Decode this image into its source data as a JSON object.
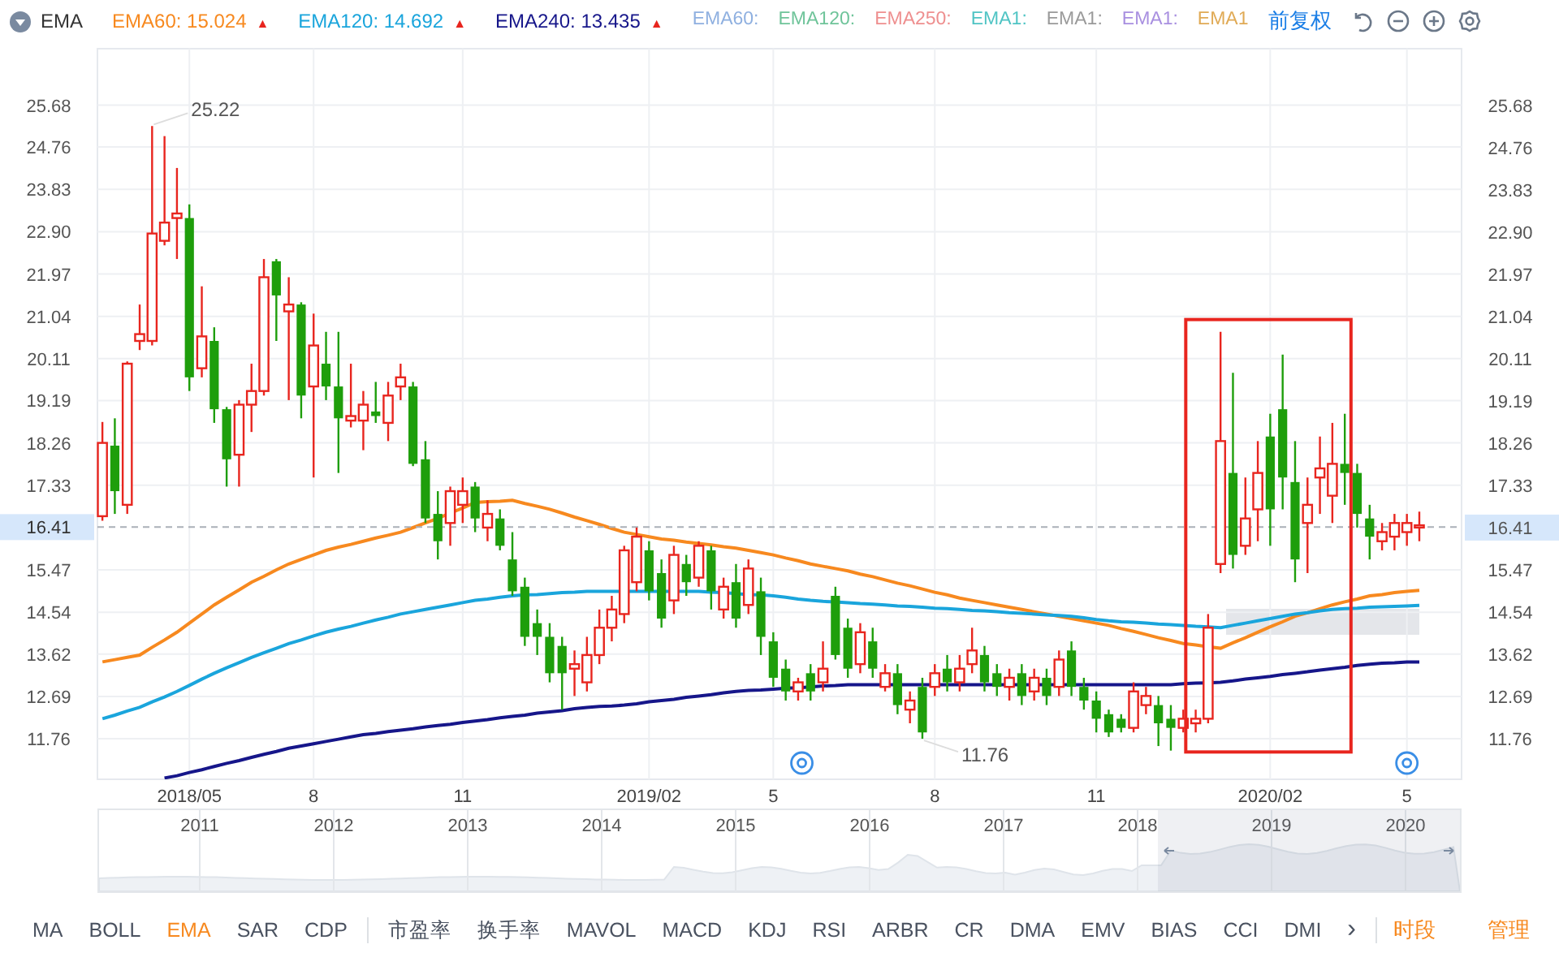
{
  "legend": {
    "indicator": "EMA",
    "values": [
      {
        "label": "EMA60: 15.024",
        "color": "#f7891f",
        "marker": "▲"
      },
      {
        "label": "EMA120: 14.692",
        "color": "#1aa5dc",
        "marker": "▲"
      },
      {
        "label": "EMA240: 13.435",
        "color": "#16168a",
        "marker": "▲"
      }
    ],
    "inactive": [
      {
        "label": "EMA60:",
        "color": "#8fb0e0"
      },
      {
        "label": "EMA120:",
        "color": "#6fc49a"
      },
      {
        "label": "EMA250:",
        "color": "#ee8f8f"
      },
      {
        "label": "EMA1:",
        "color": "#4fc4c4"
      },
      {
        "label": "EMA1:",
        "color": "#9a9a9a"
      },
      {
        "label": "EMA1:",
        "color": "#a88fe0"
      },
      {
        "label": "EMA1",
        "color": "#e0aa55"
      }
    ],
    "adjust": "前复权"
  },
  "chart_data": {
    "type": "candlestick",
    "ylim": [
      10.87,
      26.92
    ],
    "grid": true,
    "yticks": [
      {
        "value": 25.68,
        "label": "25.68"
      },
      {
        "value": 24.76,
        "label": "24.76"
      },
      {
        "value": 23.83,
        "label": "23.83"
      },
      {
        "value": 22.9,
        "label": "22.90"
      },
      {
        "value": 21.97,
        "label": "21.97"
      },
      {
        "value": 21.04,
        "label": "21.04"
      },
      {
        "value": 20.11,
        "label": "20.11"
      },
      {
        "value": 19.19,
        "label": "19.19"
      },
      {
        "value": 18.26,
        "label": "18.26"
      },
      {
        "value": 17.33,
        "label": "17.33"
      },
      {
        "value": 15.47,
        "label": "15.47"
      },
      {
        "value": 14.54,
        "label": "14.54"
      },
      {
        "value": 13.62,
        "label": "13.62"
      },
      {
        "value": 12.69,
        "label": "12.69"
      },
      {
        "value": 11.76,
        "label": "11.76"
      }
    ],
    "categories": [
      null,
      null,
      null,
      null,
      null,
      null,
      null,
      "2018/05",
      null,
      null,
      null,
      null,
      null,
      null,
      null,
      null,
      null,
      "8",
      null,
      null,
      null,
      null,
      null,
      null,
      null,
      null,
      null,
      null,
      null,
      "11",
      null,
      null,
      null,
      null,
      null,
      null,
      null,
      null,
      null,
      null,
      null,
      null,
      null,
      null,
      "2019/02",
      null,
      null,
      null,
      null,
      null,
      null,
      null,
      null,
      null,
      "5",
      null,
      null,
      null,
      null,
      null,
      null,
      null,
      null,
      null,
      null,
      null,
      null,
      "8",
      null,
      null,
      null,
      null,
      null,
      null,
      null,
      null,
      null,
      null,
      null,
      null,
      "11",
      null,
      null,
      null,
      null,
      null,
      null,
      null,
      null,
      null,
      null,
      null,
      null,
      null,
      "2020/02",
      null,
      null,
      null,
      null,
      null,
      null,
      null,
      null,
      null,
      null,
      "5",
      null
    ],
    "ohlc": [
      [
        16.65,
        18.72,
        16.55,
        18.26
      ],
      [
        18.2,
        18.8,
        16.7,
        17.2
      ],
      [
        16.9,
        20.05,
        16.7,
        20.0
      ],
      [
        20.5,
        21.3,
        20.3,
        20.65
      ],
      [
        20.5,
        25.22,
        20.4,
        22.86
      ],
      [
        22.7,
        25.0,
        22.6,
        23.1
      ],
      [
        23.2,
        24.3,
        22.3,
        23.3
      ],
      [
        23.2,
        23.5,
        19.4,
        19.7
      ],
      [
        19.9,
        21.7,
        19.7,
        20.6
      ],
      [
        20.5,
        20.8,
        18.7,
        19.0
      ],
      [
        19.0,
        19.05,
        17.3,
        17.9
      ],
      [
        18.0,
        19.2,
        17.3,
        19.1
      ],
      [
        19.1,
        20.0,
        18.5,
        19.4
      ],
      [
        19.4,
        22.3,
        19.3,
        21.9
      ],
      [
        22.25,
        22.3,
        20.5,
        21.5
      ],
      [
        21.15,
        21.9,
        19.2,
        21.3
      ],
      [
        21.3,
        21.35,
        18.8,
        19.3
      ],
      [
        19.5,
        21.1,
        17.5,
        20.4
      ],
      [
        20.0,
        20.7,
        19.2,
        19.5
      ],
      [
        19.5,
        20.7,
        17.6,
        18.8
      ],
      [
        18.75,
        20.0,
        18.6,
        18.85
      ],
      [
        18.75,
        19.4,
        18.1,
        19.1
      ],
      [
        18.95,
        19.6,
        18.7,
        18.85
      ],
      [
        18.7,
        19.6,
        18.3,
        19.3
      ],
      [
        19.5,
        20.0,
        19.2,
        19.7
      ],
      [
        19.5,
        19.6,
        17.75,
        17.8
      ],
      [
        17.9,
        18.3,
        16.5,
        16.6
      ],
      [
        16.7,
        17.2,
        15.7,
        16.1
      ],
      [
        16.5,
        17.3,
        16.0,
        17.2
      ],
      [
        16.9,
        17.5,
        16.5,
        17.2
      ],
      [
        17.3,
        17.4,
        16.3,
        16.6
      ],
      [
        16.4,
        17.0,
        16.1,
        16.7
      ],
      [
        16.6,
        16.8,
        15.9,
        16.0
      ],
      [
        15.7,
        16.3,
        14.9,
        15.0
      ],
      [
        15.1,
        15.3,
        13.8,
        14.0
      ],
      [
        14.3,
        14.6,
        13.6,
        14.0
      ],
      [
        14.0,
        14.3,
        13.0,
        13.2
      ],
      [
        13.8,
        14.0,
        12.4,
        13.2
      ],
      [
        13.3,
        13.7,
        12.7,
        13.4
      ],
      [
        13.0,
        14.0,
        12.8,
        13.6
      ],
      [
        13.6,
        14.6,
        13.4,
        14.2
      ],
      [
        14.2,
        14.9,
        13.9,
        14.6
      ],
      [
        14.5,
        16.0,
        14.3,
        15.9
      ],
      [
        15.2,
        16.4,
        15.0,
        16.2
      ],
      [
        15.9,
        16.1,
        14.8,
        15.0
      ],
      [
        15.4,
        15.7,
        14.2,
        14.4
      ],
      [
        14.8,
        16.0,
        14.5,
        15.8
      ],
      [
        15.6,
        15.8,
        14.9,
        15.2
      ],
      [
        15.3,
        16.1,
        15.1,
        16.0
      ],
      [
        15.9,
        16.0,
        14.6,
        15.0
      ],
      [
        14.6,
        15.3,
        14.4,
        15.1
      ],
      [
        15.2,
        15.6,
        14.2,
        14.4
      ],
      [
        14.7,
        15.7,
        14.5,
        15.5
      ],
      [
        15.0,
        15.3,
        13.6,
        14.0
      ],
      [
        13.9,
        14.1,
        12.9,
        13.1
      ],
      [
        13.3,
        13.5,
        12.6,
        12.8
      ],
      [
        12.8,
        13.1,
        12.6,
        13.0
      ],
      [
        13.2,
        13.4,
        12.6,
        12.8
      ],
      [
        13.0,
        13.9,
        12.8,
        13.3
      ],
      [
        14.9,
        15.1,
        13.5,
        13.6
      ],
      [
        14.2,
        14.4,
        13.1,
        13.3
      ],
      [
        13.4,
        14.3,
        13.2,
        14.1
      ],
      [
        13.9,
        14.2,
        13.1,
        13.3
      ],
      [
        12.9,
        13.4,
        12.8,
        13.2
      ],
      [
        13.2,
        13.4,
        12.3,
        12.5
      ],
      [
        12.4,
        12.8,
        12.1,
        12.6
      ],
      [
        12.9,
        13.1,
        11.76,
        11.9
      ],
      [
        12.9,
        13.4,
        12.7,
        13.2
      ],
      [
        13.3,
        13.6,
        12.8,
        13.0
      ],
      [
        13.0,
        13.6,
        12.8,
        13.3
      ],
      [
        13.4,
        14.2,
        13.2,
        13.7
      ],
      [
        13.6,
        13.8,
        12.8,
        13.0
      ],
      [
        13.2,
        13.4,
        12.7,
        12.9
      ],
      [
        12.9,
        13.3,
        12.6,
        13.1
      ],
      [
        13.2,
        13.4,
        12.5,
        12.7
      ],
      [
        12.8,
        13.3,
        12.6,
        13.1
      ],
      [
        13.1,
        13.3,
        12.5,
        12.7
      ],
      [
        12.9,
        13.7,
        12.7,
        13.5
      ],
      [
        13.7,
        13.9,
        12.7,
        12.9
      ],
      [
        12.9,
        13.1,
        12.4,
        12.6
      ],
      [
        12.6,
        12.8,
        11.9,
        12.2
      ],
      [
        12.3,
        12.4,
        11.8,
        11.9
      ],
      [
        12.2,
        12.3,
        11.9,
        12.0
      ],
      [
        12.0,
        13.0,
        11.9,
        12.8
      ],
      [
        12.5,
        12.9,
        12.3,
        12.7
      ],
      [
        12.5,
        12.7,
        11.6,
        12.1
      ],
      [
        12.2,
        12.5,
        11.5,
        12.0
      ],
      [
        12.0,
        12.4,
        11.9,
        12.2
      ],
      [
        12.1,
        12.4,
        11.9,
        12.2
      ],
      [
        12.2,
        14.5,
        12.1,
        14.2
      ],
      [
        15.6,
        20.7,
        15.4,
        18.3
      ],
      [
        17.6,
        19.8,
        15.5,
        15.8
      ],
      [
        16.0,
        17.5,
        15.8,
        16.6
      ],
      [
        16.8,
        18.3,
        16.1,
        17.6
      ],
      [
        18.4,
        18.9,
        16.0,
        16.8
      ],
      [
        19.0,
        20.2,
        16.8,
        17.5
      ],
      [
        17.4,
        18.3,
        15.2,
        15.7
      ],
      [
        16.5,
        17.5,
        15.4,
        16.9
      ],
      [
        17.5,
        18.4,
        16.7,
        17.7
      ],
      [
        17.1,
        18.7,
        16.5,
        17.8
      ],
      [
        17.8,
        18.9,
        16.9,
        17.6
      ],
      [
        17.6,
        17.8,
        16.4,
        16.7
      ],
      [
        16.6,
        16.9,
        15.7,
        16.2
      ],
      [
        16.1,
        16.5,
        15.9,
        16.3
      ],
      [
        16.2,
        16.7,
        15.9,
        16.5
      ],
      [
        16.3,
        16.7,
        16.0,
        16.5
      ],
      [
        16.4,
        16.75,
        16.1,
        16.45
      ]
    ],
    "series": [
      {
        "type": "line",
        "color": "#f7891f",
        "values": [
          13.45,
          13.5,
          13.55,
          13.6,
          13.77,
          13.93,
          14.1,
          14.3,
          14.5,
          14.7,
          14.87,
          15.03,
          15.2,
          15.33,
          15.47,
          15.6,
          15.7,
          15.8,
          15.9,
          15.97,
          16.03,
          16.1,
          16.17,
          16.23,
          16.3,
          16.4,
          16.5,
          16.6,
          16.72,
          16.83,
          16.95,
          16.97,
          16.98,
          17.0,
          16.93,
          16.87,
          16.8,
          16.72,
          16.63,
          16.55,
          16.47,
          16.38,
          16.3,
          16.25,
          16.2,
          16.15,
          16.12,
          16.08,
          16.05,
          16.02,
          15.98,
          15.95,
          15.9,
          15.85,
          15.8,
          15.73,
          15.67,
          15.6,
          15.55,
          15.5,
          15.45,
          15.38,
          15.32,
          15.25,
          15.18,
          15.12,
          15.05,
          14.98,
          14.92,
          14.85,
          14.8,
          14.75,
          14.7,
          14.65,
          14.6,
          14.55,
          14.5,
          14.45,
          14.4,
          14.35,
          14.3,
          14.25,
          14.18,
          14.12,
          14.05,
          13.98,
          13.92,
          13.85,
          13.82,
          13.78,
          13.75,
          13.87,
          13.98,
          14.1,
          14.22,
          14.33,
          14.45,
          14.53,
          14.62,
          14.7,
          14.77,
          14.83,
          14.9,
          14.93,
          14.97,
          15.0,
          15.02
        ]
      },
      {
        "type": "line",
        "color": "#1aa5dc",
        "values": [
          12.2,
          12.28,
          12.37,
          12.45,
          12.57,
          12.68,
          12.8,
          12.93,
          13.07,
          13.2,
          13.32,
          13.43,
          13.55,
          13.65,
          13.75,
          13.85,
          13.93,
          14.02,
          14.1,
          14.17,
          14.23,
          14.3,
          14.37,
          14.43,
          14.5,
          14.55,
          14.6,
          14.65,
          14.7,
          14.75,
          14.8,
          14.83,
          14.87,
          14.9,
          14.92,
          14.93,
          14.95,
          14.97,
          14.98,
          15.0,
          15.0,
          15.0,
          15.0,
          15.0,
          15.0,
          15.0,
          15.0,
          15.0,
          15.0,
          14.98,
          14.97,
          14.95,
          14.93,
          14.92,
          14.9,
          14.87,
          14.83,
          14.8,
          14.78,
          14.77,
          14.75,
          14.73,
          14.72,
          14.7,
          14.68,
          14.67,
          14.65,
          14.63,
          14.62,
          14.6,
          14.58,
          14.57,
          14.55,
          14.53,
          14.52,
          14.5,
          14.48,
          14.47,
          14.45,
          14.42,
          14.38,
          14.35,
          14.33,
          14.32,
          14.3,
          14.28,
          14.27,
          14.25,
          14.23,
          14.22,
          14.2,
          14.25,
          14.3,
          14.35,
          14.4,
          14.45,
          14.5,
          14.53,
          14.57,
          14.6,
          14.62,
          14.63,
          14.65,
          14.66,
          14.67,
          14.68,
          14.69
        ]
      },
      {
        "type": "line",
        "color": "#16168a",
        "values": [
          null,
          null,
          null,
          null,
          null,
          10.9,
          10.95,
          11.02,
          11.08,
          11.15,
          11.22,
          11.28,
          11.35,
          11.42,
          11.48,
          11.55,
          11.6,
          11.65,
          11.7,
          11.75,
          11.8,
          11.85,
          11.88,
          11.92,
          11.95,
          11.98,
          12.02,
          12.05,
          12.08,
          12.12,
          12.15,
          12.18,
          12.22,
          12.25,
          12.28,
          12.32,
          12.35,
          12.38,
          12.42,
          12.45,
          12.47,
          12.48,
          12.5,
          12.53,
          12.57,
          12.6,
          12.63,
          12.67,
          12.7,
          12.73,
          12.77,
          12.8,
          12.82,
          12.83,
          12.85,
          12.87,
          12.88,
          12.9,
          12.92,
          12.93,
          12.95,
          12.95,
          12.95,
          12.95,
          12.95,
          12.95,
          12.95,
          12.95,
          12.95,
          12.95,
          12.95,
          12.95,
          12.95,
          12.95,
          12.95,
          12.95,
          12.95,
          12.95,
          12.95,
          12.95,
          12.95,
          12.95,
          12.95,
          12.95,
          12.95,
          12.95,
          12.95,
          12.97,
          12.98,
          12.99,
          13.0,
          13.03,
          13.07,
          13.1,
          13.13,
          13.17,
          13.2,
          13.23,
          13.27,
          13.3,
          13.33,
          13.37,
          13.4,
          13.42,
          13.43,
          13.45,
          13.45
        ]
      }
    ],
    "annotations": [
      {
        "text": "25.22"
      },
      {
        "text": "11.76"
      }
    ],
    "ref_lines": [
      {
        "axis": "y",
        "value": 16.41,
        "label": "16.41"
      }
    ]
  },
  "right_axis": [
    "25.68",
    "24.76",
    "23.83",
    "22.90",
    "21.97",
    "21.04",
    "20.11",
    "19.19",
    "18.26",
    "17.33",
    "16.41",
    "15.47",
    "14.54",
    "13.62",
    "12.69",
    "11.76"
  ],
  "navigator": {
    "years": [
      "2011",
      "2012",
      "2013",
      "2014",
      "2015",
      "2016",
      "2017",
      "2018",
      "2019",
      "2020"
    ]
  },
  "tabs": [
    {
      "label": "MA",
      "selected": false
    },
    {
      "label": "BOLL",
      "selected": false
    },
    {
      "label": "EMA",
      "selected": true
    },
    {
      "label": "SAR",
      "selected": false
    },
    {
      "label": "CDP",
      "selected": false
    },
    {
      "label": "市盈率",
      "selected": false
    },
    {
      "label": "换手率",
      "selected": false
    },
    {
      "label": "MAVOL",
      "selected": false
    },
    {
      "label": "MACD",
      "selected": false
    },
    {
      "label": "KDJ",
      "selected": false
    },
    {
      "label": "RSI",
      "selected": false
    },
    {
      "label": "ARBR",
      "selected": false
    },
    {
      "label": "CR",
      "selected": false
    },
    {
      "label": "DMA",
      "selected": false
    },
    {
      "label": "EMV",
      "selected": false
    },
    {
      "label": "BIAS",
      "selected": false
    },
    {
      "label": "CCI",
      "selected": false
    },
    {
      "label": "DMI",
      "selected": false
    }
  ],
  "tab_more": "›",
  "actions": [
    "时段",
    "管理"
  ]
}
